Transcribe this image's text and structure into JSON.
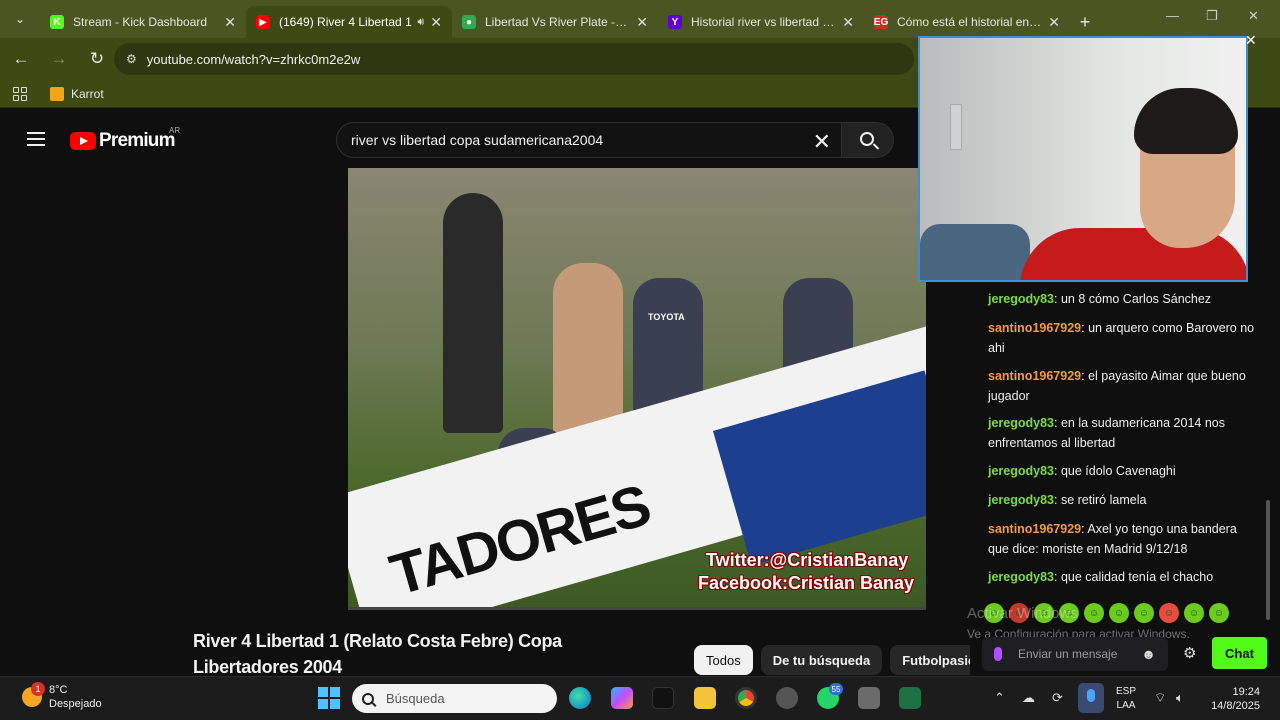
{
  "browser": {
    "tabs": [
      {
        "title": "Stream - Kick Dashboard",
        "fav_color": "#53fc18",
        "fav_glyph": "K"
      },
      {
        "title": "(1649) River 4 Libertad 1",
        "fav_color": "#ff0000",
        "fav_glyph": "▶",
        "active": true
      },
      {
        "title": "Libertad Vs River Plate - Res",
        "fav_color": "#34a853",
        "fav_glyph": "●"
      },
      {
        "title": "Historial river vs libertad - Y",
        "fav_color": "#6001d2",
        "fav_glyph": "Y"
      },
      {
        "title": "Cómo está el historial entre",
        "fav_color": "#d6281c",
        "fav_glyph": "EG"
      }
    ],
    "url": "youtube.com/watch?v=zhrkc0m2e2w",
    "bookmarks": [
      {
        "label": "Karrot"
      }
    ]
  },
  "youtube": {
    "logo": "Premium",
    "country": "AR",
    "search_value": "river vs libertad copa sudamericana2004",
    "video_overlay": [
      "Twitter:@CristianBanay",
      "Facebook:Cristian Banay"
    ],
    "banner_text": "TADORES",
    "sponsor": "TOYOTA",
    "video_title": "River 4 Libertad 1 (Relato Costa Febre) Copa Libertadores 2004",
    "chips": [
      "Todos",
      "De tu búsqueda",
      "Futbolpasion"
    ]
  },
  "chat": {
    "messages": [
      {
        "user": "jeregody83",
        "color": "#7ddc3a",
        "text": "un 8 cómo Carlos Sánchez"
      },
      {
        "user": "santino1967929",
        "color": "#f39c34",
        "text": "un arquero como Barovero no ahi"
      },
      {
        "user": "santino1967929",
        "color": "#f39c34",
        "text": "el payasito Aimar que bueno jugador"
      },
      {
        "user": "jeregody83",
        "color": "#7ddc3a",
        "text": "en la sudamericana 2014 nos enfrentamos al libertad"
      },
      {
        "user": "jeregody83",
        "color": "#7ddc3a",
        "text": "que ídolo Cavenaghi"
      },
      {
        "user": "jeregody83",
        "color": "#7ddc3a",
        "text": "se retiró lamela"
      },
      {
        "user": "santino1967929",
        "color": "#f39c34",
        "text": "Axel yo tengo una bandera que dice: moriste en Madrid 9/12/18"
      },
      {
        "user": "jeregody83",
        "color": "#7ddc3a",
        "text": "que calidad tenía el chacho"
      }
    ],
    "input_placeholder": "Enviar un mensaje",
    "send_label": "Chat",
    "accent": "#53fc18"
  },
  "windows": {
    "activate_title": "Activar Windows",
    "activate_sub": "Ve a Configuración para activar Windows.",
    "weather_temp": "8°C",
    "weather_desc": "Despejado",
    "weather_badge": "1",
    "search_placeholder": "Búsqueda",
    "whatsapp_badge": "55",
    "lang": "ESP",
    "lang2": "LAA",
    "time": "19:24",
    "date": "14/8/2025"
  }
}
